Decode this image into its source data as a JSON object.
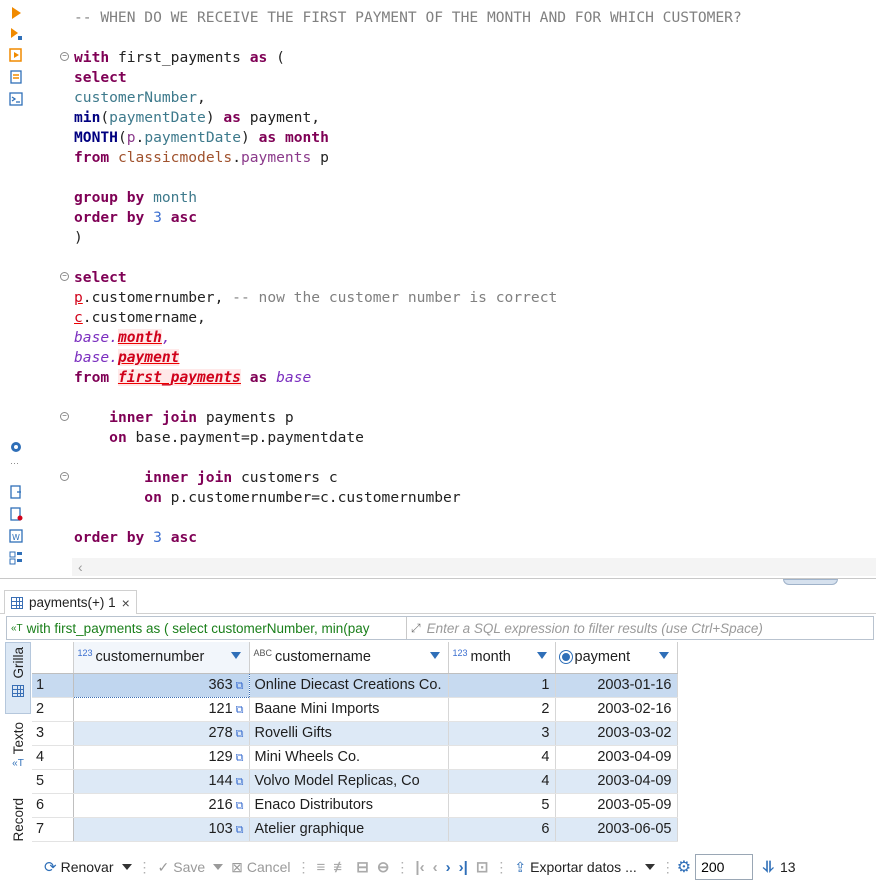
{
  "editor": {
    "lines": [
      {
        "cls": "cm",
        "text": "-- WHEN DO WE RECEIVE THE FIRST PAYMENT OF THE MONTH AND FOR WHICH CUSTOMER?"
      },
      {
        "blank": true
      },
      {
        "parts": [
          [
            "kw",
            "with"
          ],
          [
            "pl",
            " first_payments "
          ],
          [
            "kw",
            "as"
          ],
          [
            "pl",
            " ("
          ]
        ]
      },
      {
        "parts": [
          [
            "kw",
            "select"
          ]
        ]
      },
      {
        "parts": [
          [
            "col",
            "customerNumber"
          ],
          [
            "pl",
            ","
          ]
        ]
      },
      {
        "parts": [
          [
            "kwb",
            "min"
          ],
          [
            "pl",
            "("
          ],
          [
            "col",
            "paymentDate"
          ],
          [
            "pl",
            ") "
          ],
          [
            "kw",
            "as"
          ],
          [
            "pl",
            " payment,"
          ]
        ]
      },
      {
        "parts": [
          [
            "kwb",
            "MONTH"
          ],
          [
            "pl",
            "("
          ],
          [
            "tb",
            "p"
          ],
          [
            "pl",
            "."
          ],
          [
            "col",
            "paymentDate"
          ],
          [
            "pl",
            ") "
          ],
          [
            "kw",
            "as"
          ],
          [
            "pl",
            " "
          ],
          [
            "kw",
            "month"
          ]
        ]
      },
      {
        "parts": [
          [
            "kw",
            "from"
          ],
          [
            "pl",
            " "
          ],
          [
            "sch",
            "classicmodels"
          ],
          [
            "pl",
            "."
          ],
          [
            "tb",
            "payments"
          ],
          [
            "pl",
            " p"
          ]
        ]
      },
      {
        "blank": true
      },
      {
        "parts": [
          [
            "kw",
            "group by"
          ],
          [
            "pl",
            " "
          ],
          [
            "col",
            "month"
          ]
        ]
      },
      {
        "parts": [
          [
            "kw",
            "order by"
          ],
          [
            "pl",
            " "
          ],
          [
            "num",
            "3"
          ],
          [
            "pl",
            " "
          ],
          [
            "kw",
            "asc"
          ]
        ]
      },
      {
        "parts": [
          [
            "pl",
            ")"
          ]
        ]
      },
      {
        "blank": true
      },
      {
        "parts": [
          [
            "kw",
            "select"
          ]
        ]
      },
      {
        "parts": [
          [
            "erl",
            "p"
          ],
          [
            "pl",
            ".customernumber, "
          ],
          [
            "cm",
            "-- now the customer number is correct"
          ]
        ]
      },
      {
        "parts": [
          [
            "erl",
            "c"
          ],
          [
            "pl",
            ".customername,"
          ]
        ]
      },
      {
        "parts": [
          [
            "al",
            "base"
          ],
          [
            "al",
            "."
          ],
          [
            "err",
            "month"
          ],
          [
            "al",
            ","
          ]
        ]
      },
      {
        "parts": [
          [
            "al",
            "base"
          ],
          [
            "al",
            "."
          ],
          [
            "err",
            "payment"
          ]
        ]
      },
      {
        "parts": [
          [
            "kw",
            "from"
          ],
          [
            "pl",
            " "
          ],
          [
            "err",
            "first_payments"
          ],
          [
            "pl",
            " "
          ],
          [
            "kw",
            "as"
          ],
          [
            "pl",
            " "
          ],
          [
            "al",
            "base"
          ]
        ]
      },
      {
        "blank": true
      },
      {
        "parts": [
          [
            "pl",
            "    "
          ],
          [
            "kw",
            "inner join"
          ],
          [
            "pl",
            " payments p"
          ]
        ]
      },
      {
        "parts": [
          [
            "pl",
            "    "
          ],
          [
            "kw",
            "on"
          ],
          [
            "pl",
            " base.payment=p.paymentdate"
          ]
        ]
      },
      {
        "blank": true
      },
      {
        "parts": [
          [
            "pl",
            "        "
          ],
          [
            "kw",
            "inner join"
          ],
          [
            "pl",
            " customers c"
          ]
        ]
      },
      {
        "parts": [
          [
            "pl",
            "        "
          ],
          [
            "kw",
            "on"
          ],
          [
            "pl",
            " p.customernumber=c.customernumber"
          ]
        ]
      },
      {
        "blank": true
      },
      {
        "parts": [
          [
            "kw",
            "order by"
          ],
          [
            "pl",
            " "
          ],
          [
            "num",
            "3"
          ],
          [
            "pl",
            " "
          ],
          [
            "kw",
            "asc"
          ]
        ]
      }
    ]
  },
  "results": {
    "tab_label": "payments(+) 1",
    "query_preview": "with first_payments as ( select customerNumber, min(pay",
    "filter_placeholder": "Enter a SQL expression to filter results (use Ctrl+Space)",
    "side_tabs": [
      "Grilla",
      "Texto",
      "Record"
    ],
    "columns": [
      {
        "type": "123",
        "name": "customernumber"
      },
      {
        "type": "ABC",
        "name": "customername"
      },
      {
        "type": "123",
        "name": "month"
      },
      {
        "type": "date",
        "name": "payment"
      }
    ],
    "rows": [
      {
        "n": "1",
        "customernumber": "363",
        "customername": "Online Diecast Creations Co.",
        "month": "1",
        "payment": "2003-01-16"
      },
      {
        "n": "2",
        "customernumber": "121",
        "customername": "Baane Mini Imports",
        "month": "2",
        "payment": "2003-02-16"
      },
      {
        "n": "3",
        "customernumber": "278",
        "customername": "Rovelli Gifts",
        "month": "3",
        "payment": "2003-03-02"
      },
      {
        "n": "4",
        "customernumber": "129",
        "customername": "Mini Wheels Co.",
        "month": "4",
        "payment": "2003-04-09"
      },
      {
        "n": "5",
        "customernumber": "144",
        "customername": "Volvo Model Replicas, Co",
        "month": "4",
        "payment": "2003-04-09"
      },
      {
        "n": "6",
        "customernumber": "216",
        "customername": "Enaco Distributors",
        "month": "5",
        "payment": "2003-05-09"
      },
      {
        "n": "7",
        "customernumber": "103",
        "customername": "Atelier graphique",
        "month": "6",
        "payment": "2003-06-05"
      }
    ]
  },
  "toolbar": {
    "refresh_label": "Renovar",
    "save_label": "Save",
    "cancel_label": "Cancel",
    "export_label": "Exportar datos ...",
    "fetch_size": "200",
    "row_count": "13"
  },
  "colors": {
    "keyword": "#7f0055",
    "selection": "#c7daf0",
    "stripe": "#dde9f6",
    "accent": "#2f6fb8"
  }
}
